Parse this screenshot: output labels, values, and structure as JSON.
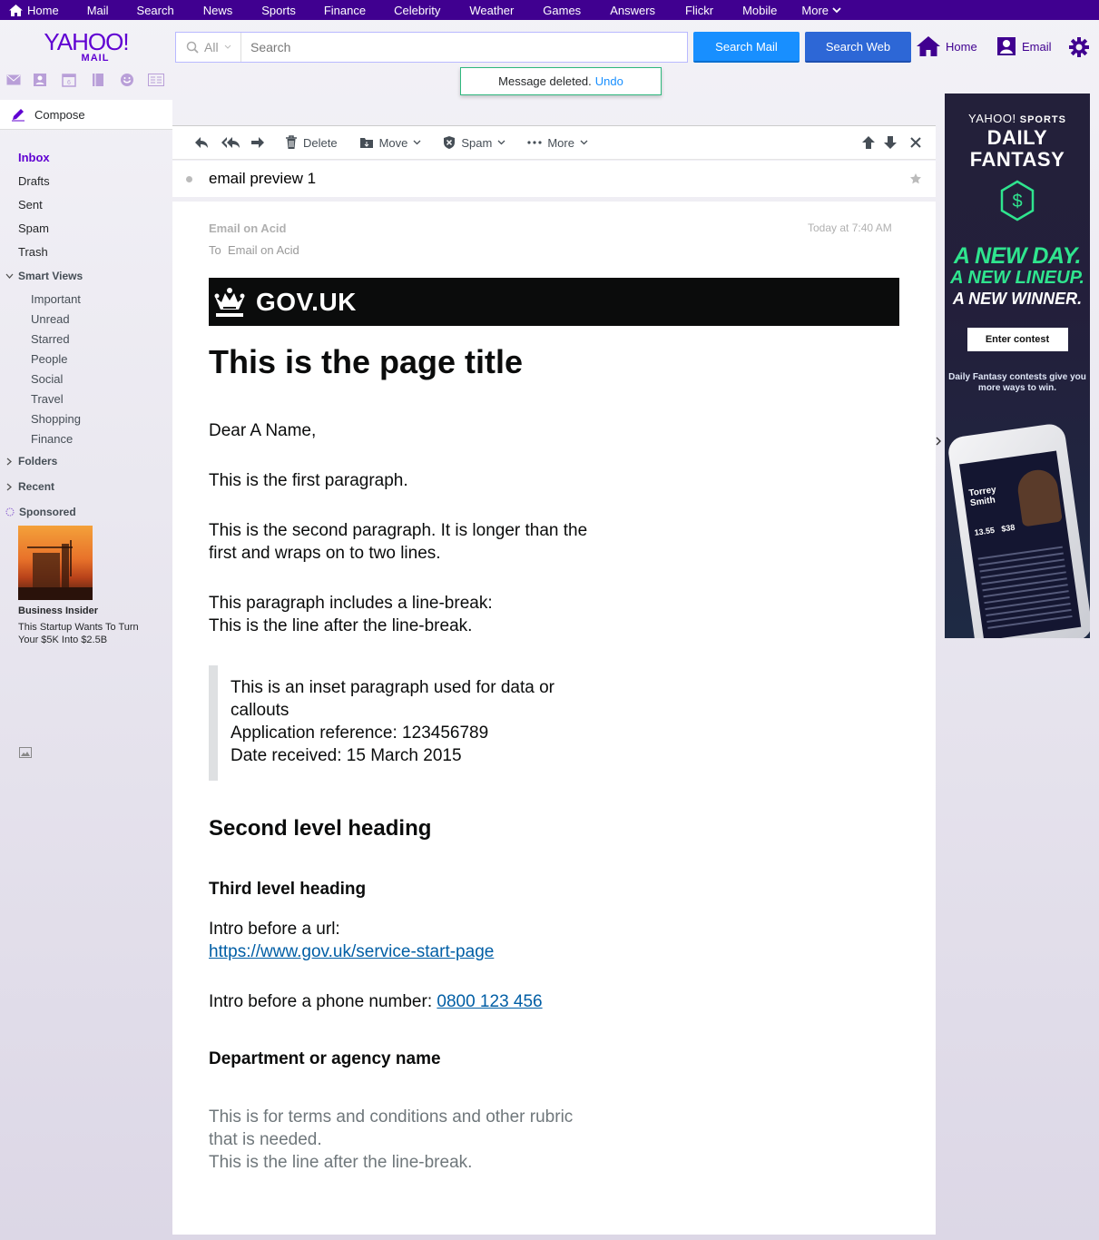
{
  "topnav": {
    "home": "Home",
    "items": [
      "Mail",
      "Search",
      "News",
      "Sports",
      "Finance",
      "Celebrity",
      "Weather",
      "Games",
      "Answers",
      "Flickr",
      "Mobile"
    ],
    "more": "More"
  },
  "logo": {
    "brand": "YAHOO!",
    "product": "MAIL"
  },
  "search": {
    "scope": "All",
    "placeholder": "Search",
    "mail_button": "Search Mail",
    "web_button": "Search Web"
  },
  "header": {
    "home": "Home",
    "email": "Email"
  },
  "toast": {
    "text": "Message deleted.",
    "undo": "Undo"
  },
  "sidebar": {
    "compose": "Compose",
    "folders": [
      "Inbox",
      "Drafts",
      "Sent",
      "Spam",
      "Trash"
    ],
    "smart_views_label": "Smart Views",
    "smart_views": [
      "Important",
      "Unread",
      "Starred",
      "People",
      "Social",
      "Travel",
      "Shopping",
      "Finance"
    ],
    "folders_label": "Folders",
    "recent_label": "Recent",
    "sponsored_label": "Sponsored",
    "sponsor_source": "Business Insider",
    "sponsor_text": "This Startup Wants To Turn Your $5K Into $2.5B"
  },
  "toolbar": {
    "delete": "Delete",
    "move": "Move",
    "spam": "Spam",
    "more": "More"
  },
  "message": {
    "subject": "email preview 1",
    "from": "Email on Acid",
    "to_label": "To",
    "to": "Email on Acid",
    "date": "Today at 7:40 AM",
    "gov_logo": "GOV.UK",
    "title": "This is the page title",
    "greeting": "Dear A Name,",
    "p1": "This is the first paragraph.",
    "p2": "This is the second paragraph. It is longer than the first and wraps on to two lines.",
    "p3a": "This paragraph includes a line-break:",
    "p3b": "This is the line after the line-break.",
    "inset_a": "This is an inset paragraph used for data or callouts",
    "inset_b": "Application reference: 123456789",
    "inset_c": "Date received: 15 March 2015",
    "h2": "Second level heading",
    "h3": "Third level heading",
    "url_intro": "Intro before a url:",
    "url": "https://www.gov.uk/service-start-page",
    "phone_intro": "Intro before a phone number:",
    "phone": "0800 123 456",
    "dept": "Department or agency name",
    "rubric_a": "This is for terms and conditions and other rubric that is needed.",
    "rubric_b": "This is the line after the line-break."
  },
  "ad": {
    "brand": "YAHOO!",
    "brand_sub": "SPORTS",
    "title1": "DAILY",
    "title2": "FANTASY",
    "line1": "A NEW DAY.",
    "line2": "A NEW LINEUP.",
    "line3": "A NEW WINNER.",
    "cta": "Enter contest",
    "small": "Daily Fantasy contests give you more ways to win.",
    "player": "Torrey Smith",
    "stat1": "13.55",
    "stat2": "$38"
  },
  "colors": {
    "nav": "#400090",
    "brand": "#6001d2",
    "search_mail": "#188fff",
    "search_web": "#2d67d6",
    "link": "#005ea5",
    "ad_green": "#2fe48e"
  }
}
